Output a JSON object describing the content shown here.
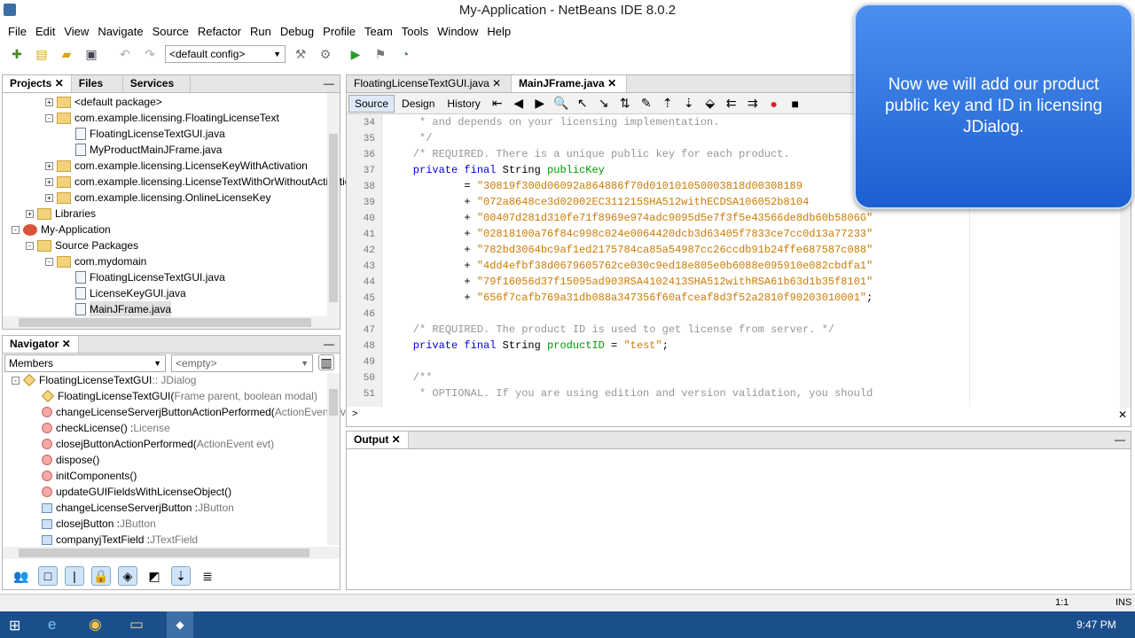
{
  "window": {
    "title": "My-Application - NetBeans IDE 8.0.2"
  },
  "menu": [
    "File",
    "Edit",
    "View",
    "Navigate",
    "Source",
    "Refactor",
    "Run",
    "Debug",
    "Profile",
    "Team",
    "Tools",
    "Window",
    "Help"
  ],
  "toolbar": {
    "config": "<default config>"
  },
  "projects": {
    "tabs": [
      "Projects",
      "Files",
      "Services"
    ],
    "tree": [
      {
        "label": "<default package>",
        "icon": "package"
      },
      {
        "label": "com.example.licensing.FloatingLicenseText",
        "icon": "package"
      },
      {
        "label": "FloatingLicenseTextGUI.java",
        "icon": "file"
      },
      {
        "label": "MyProductMainJFrame.java",
        "icon": "file"
      },
      {
        "label": "com.example.licensing.LicenseKeyWithActivation",
        "icon": "package"
      },
      {
        "label": "com.example.licensing.LicenseTextWithOrWithoutActivatio",
        "icon": "package"
      },
      {
        "label": "com.example.licensing.OnlineLicenseKey",
        "icon": "package"
      },
      {
        "label": "Libraries",
        "icon": "folder"
      },
      {
        "label": "My-Application",
        "icon": "project"
      },
      {
        "label": "Source Packages",
        "icon": "folder"
      },
      {
        "label": "com.mydomain",
        "icon": "package"
      },
      {
        "label": "FloatingLicenseTextGUI.java",
        "icon": "file"
      },
      {
        "label": "LicenseKeyGUI.java",
        "icon": "file"
      },
      {
        "label": "MainJFrame.java",
        "icon": "file"
      }
    ]
  },
  "navigator": {
    "title": "Navigator",
    "filter": "Members",
    "empty": "<empty>",
    "items": [
      {
        "name": "FloatingLicenseTextGUI",
        "type": " :: JDialog",
        "icon": "class"
      },
      {
        "name": "FloatingLicenseTextGUI(",
        "type": "Frame parent, boolean modal)",
        "icon": "constructor"
      },
      {
        "name": "changeLicenseServerjButtonActionPerformed(",
        "type": "ActionEvent evt)",
        "icon": "private-method"
      },
      {
        "name": "checkLicense() : ",
        "type": "License",
        "icon": "method"
      },
      {
        "name": "closejButtonActionPerformed(",
        "type": "ActionEvent evt)",
        "icon": "private-method"
      },
      {
        "name": "dispose()",
        "type": "",
        "icon": "method"
      },
      {
        "name": "initComponents()",
        "type": "",
        "icon": "private-method"
      },
      {
        "name": "updateGUIFieldsWithLicenseObject()",
        "type": "",
        "icon": "private-method"
      },
      {
        "name": "changeLicenseServerjButton : ",
        "type": "JButton",
        "icon": "field"
      },
      {
        "name": "closejButton : ",
        "type": "JButton",
        "icon": "field"
      },
      {
        "name": "companyjTextField : ",
        "type": "JTextField",
        "icon": "field"
      }
    ]
  },
  "editor": {
    "tabs": [
      "FloatingLicenseTextGUI.java",
      "MainJFrame.java"
    ],
    "modes": [
      "Source",
      "Design",
      "History"
    ],
    "lines": [
      {
        "n": "34",
        "parts": [
          [
            "cm",
            "     * and depends on your licensing implementation."
          ]
        ]
      },
      {
        "n": "35",
        "parts": [
          [
            "cm",
            "     */"
          ]
        ]
      },
      {
        "n": "36",
        "parts": [
          [
            "cm",
            "    /* REQUIRED. There is a unique public key for each product."
          ]
        ]
      },
      {
        "n": "37",
        "parts": [
          [
            "kw",
            "    private final "
          ],
          [
            "",
            "String "
          ],
          [
            "id",
            "publicKey"
          ]
        ]
      },
      {
        "n": "38",
        "parts": [
          [
            "",
            "            = "
          ],
          [
            "st",
            "\"30819f300d06092a864886f70d010101050003818d00308189"
          ]
        ]
      },
      {
        "n": "39",
        "parts": [
          [
            "",
            "            + "
          ],
          [
            "st",
            "\"072a8648ce3d02002EC311215SHA512withECDSA106052b8104"
          ]
        ]
      },
      {
        "n": "40",
        "parts": [
          [
            "",
            "            + "
          ],
          [
            "st",
            "\"00407d281d310fe71f8969e974adc9095d5e7f3f5e43566de8db60b5806G\""
          ]
        ]
      },
      {
        "n": "41",
        "parts": [
          [
            "",
            "            + "
          ],
          [
            "st",
            "\"02818100a76f84c998c024e0064420dcb3d63405f7833ce7cc0d13a77233\""
          ]
        ]
      },
      {
        "n": "42",
        "parts": [
          [
            "",
            "            + "
          ],
          [
            "st",
            "\"782bd3064bc9af1ed2175784ca85a54987cc26ccdb91b24ffe687587c088\""
          ]
        ]
      },
      {
        "n": "43",
        "parts": [
          [
            "",
            "            + "
          ],
          [
            "st",
            "\"4dd4efbf38d0679605762ce030c9ed18e805e0b6088e095910e082cbdfa1\""
          ]
        ]
      },
      {
        "n": "44",
        "parts": [
          [
            "",
            "            + "
          ],
          [
            "st",
            "\"79f16056d37f15095ad903RSA4102413SHA512withRSA61b63d1b35f8101\""
          ]
        ]
      },
      {
        "n": "45",
        "parts": [
          [
            "",
            "            + "
          ],
          [
            "st",
            "\"656f7cafb769a31db088a347356f60afceaf8d3f52a2810f90203010001\""
          ],
          [
            "",
            ";"
          ]
        ]
      },
      {
        "n": "46",
        "parts": [
          [
            "",
            ""
          ]
        ]
      },
      {
        "n": "47",
        "parts": [
          [
            "cm",
            "    /* REQUIRED. The product ID is used to get license from server. */"
          ]
        ]
      },
      {
        "n": "48",
        "parts": [
          [
            "kw",
            "    private final "
          ],
          [
            "",
            "String "
          ],
          [
            "id",
            "productID"
          ],
          [
            "",
            " = "
          ],
          [
            "st",
            "\"test\""
          ],
          [
            "",
            ";"
          ]
        ]
      },
      {
        "n": "49",
        "parts": [
          [
            "",
            ""
          ]
        ]
      },
      {
        "n": "50",
        "parts": [
          [
            "cm",
            "    /**"
          ]
        ]
      },
      {
        "n": "51",
        "parts": [
          [
            "cm",
            "     * OPTIONAL. If you are using edition and version validation, you should"
          ]
        ]
      }
    ]
  },
  "output": {
    "title": "Output"
  },
  "status": {
    "position": "1:1",
    "mode": "INS"
  },
  "taskbar": {
    "time": "9:47 PM"
  },
  "callout": {
    "text": "Now we will add our product public key and ID in licensing JDialog."
  }
}
